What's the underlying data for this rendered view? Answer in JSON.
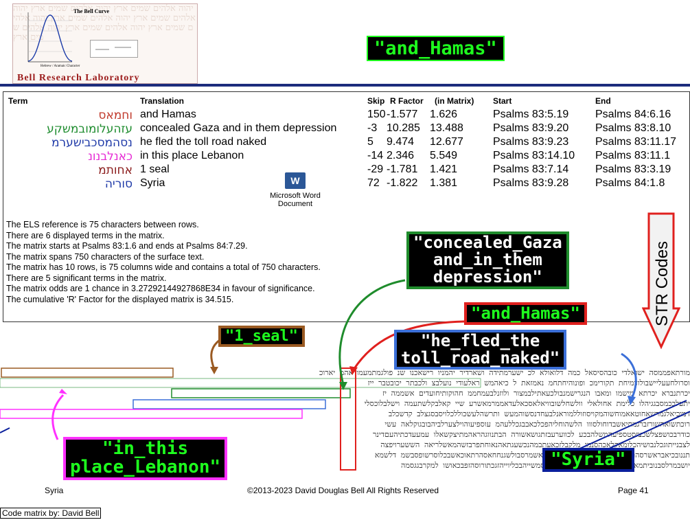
{
  "header": {
    "logo_chart_title": "The Bell Curve",
    "logo_x_label": "Hebrew / Aramaic Character",
    "logo_lab_name": "Bell Research Laboratory",
    "banner": "\"and_Hamas\""
  },
  "table": {
    "headers": {
      "term": "Term",
      "translation": "Translation",
      "skip": "Skip",
      "rfactor": "R Factor",
      "inmatrix": "(in Matrix)",
      "start": "Start",
      "end": "End"
    },
    "rows": [
      {
        "heb": "וחמאס",
        "color": "#c0392b",
        "translation": "and Hamas",
        "skip": "150",
        "rfactor": "-1.577",
        "inmatrix": "1.626",
        "start": "Psalms 83:5.19",
        "end": "Psalms 84:6.16"
      },
      {
        "heb": "עזהעלומובמשקע",
        "color": "#1e8c2e",
        "translation": "concealed Gaza and in them depression",
        "skip": "-3",
        "rfactor": "10.285",
        "inmatrix": "13.488",
        "start": "Psalms 83:9.20",
        "end": "Psalms 83:8.10"
      },
      {
        "heb": "נסהמסכבישערמ",
        "color": "#1f3aa8",
        "translation": "he fled the toll road naked",
        "skip": "5",
        "rfactor": "9.474",
        "inmatrix": "12.677",
        "start": "Psalms 83:9.23",
        "end": "Psalms 83:11.17"
      },
      {
        "heb": "כאנלבנונ",
        "color": "#e62ad4",
        "translation": "in this place Lebanon",
        "skip": "-14",
        "rfactor": "2.346",
        "inmatrix": "5.549",
        "start": "Psalms 83:14.10",
        "end": "Psalms 83:11.1"
      },
      {
        "heb": "אחותמ",
        "color": "#8a1b1b",
        "translation": "1 seal",
        "skip": "-29",
        "rfactor": "-1.781",
        "inmatrix": "1.421",
        "start": "Psalms 83:7.14",
        "end": "Psalms 83:3.19"
      },
      {
        "heb": "סוריה",
        "color": "#1f3aa8",
        "translation": "Syria",
        "skip": "72",
        "rfactor": "-1.822",
        "inmatrix": "1.381",
        "start": "Psalms 83:9.28",
        "end": "Psalms 84:1.8"
      }
    ]
  },
  "word_icon": {
    "line1": "Microsoft Word",
    "line2": "Document"
  },
  "notes": [
    "The ELS reference is 75 characters between rows.",
    "There are 6 displayed terms in the matrix.",
    "The matrix starts at Psalms 83:1.6 and ends at Psalms 84:7.29.",
    "The matrix spans 750 characters of the surface text.",
    "The matrix has 10 rows, is 75 columns wide and contains a total of 750 characters.",
    "There are 5 significant terms in the matrix.",
    "The matrix odds are 1 chance in 3.27292144927868E34  in favour of significance.",
    "The cumulative 'R' Factor for the displayed matrix is 34.515."
  ],
  "labels": {
    "concealed": "\"concealed_Gaza\nand_in_them\ndepression\"",
    "hamas": "\"and_Hamas\"",
    "seal": "\"1_seal\"",
    "fled": "\"he_fled_the\ntoll_road_naked\"",
    "lebanon": "\"in_this\nplace_Lebanon\"",
    "syria": "\"Syria\"",
    "str": "STR Codes"
  },
  "matrix_rows": [
    "מורתאפממסה ישואלדי כובהסיסאל כמה דלואולא לכ ישערמתידה ושארדיר יהמניו רישאכנו שנ פולגמתמעמודאהמ יארוכ",
    "וסרולחעעליישבולודמיחת תקורימכ ופונוהיחתחמ נאמזאת ל כיאהמש ראלעודי נועלבצ ולכבתר יכובטבר ייז",
    "יכרתנברא יכרתא מישמו ומאבו הנגרישמנבולכעאתילבמצור ולוזנלבעמחממ חהוקותיחועדים אשממה יז",
    "יתעלבכמסבגגיהלו כלימת אחולאלי וולשחלשובוויאלאסכאלעדאממרמאשרע שיי קאלבקלשתעמה וישלבלוכסלי",
    "דמוכיאלגמרשאחוטאאמוחשוהמקויסוזוללמוראנלבעחדנסשוהמעש ותרשהלעשכוללכלויסבסגצלב קדשכלב",
    "רוכתשואהשורזברגמתיאשבדוחולסווו הלשהוחליהפכלכאבבגכללעהמ עוספיעוהוילצערלביהבובגוקלאה עשי",
    "כודרבכושפצלשכצזסטספיעהמשלהבכע לכווערעבזתגושאשורה הבתנווגהראהמתיצקשאלו עמעעדכתיהעםדינר",
    "לצבנייתוגכלנבושיהכלומאקלאכהסנמו מלקבלזכאעתבמהנכשעגתאהנאוחתפרבזשהמאשלריאה הששערויפצה",
    "תננובכיאבראשרסהוראיתהנוהבזחלמבפאשמולחוצאואשמרסבולשגנחחאסהרתאוכאשבכלוסרשופסבשמ דלשמא",
    "יושבמרלסבנוביתמאשרודישמלדנבוכשלאהשנ אחתסמשייהבכליוייהזגכתורוסהזפבכאושו למקרבגגסמה"
  ],
  "footer": {
    "left": "Syria",
    "center": "©2013-2023 David Douglas Bell All Rights Reserved",
    "right": "Page 41",
    "credit": "Code matrix by: David Bell"
  },
  "colors": {
    "banner_green": "#1eff1e",
    "hamas_red": "#e0201e",
    "concealed_green": "#1f8c2c",
    "fled_blue": "#3b6fd8",
    "lebanon_magenta": "#ff30ff",
    "seal_brown": "#9a5a22",
    "syria_navy": "#0a1f9c"
  }
}
